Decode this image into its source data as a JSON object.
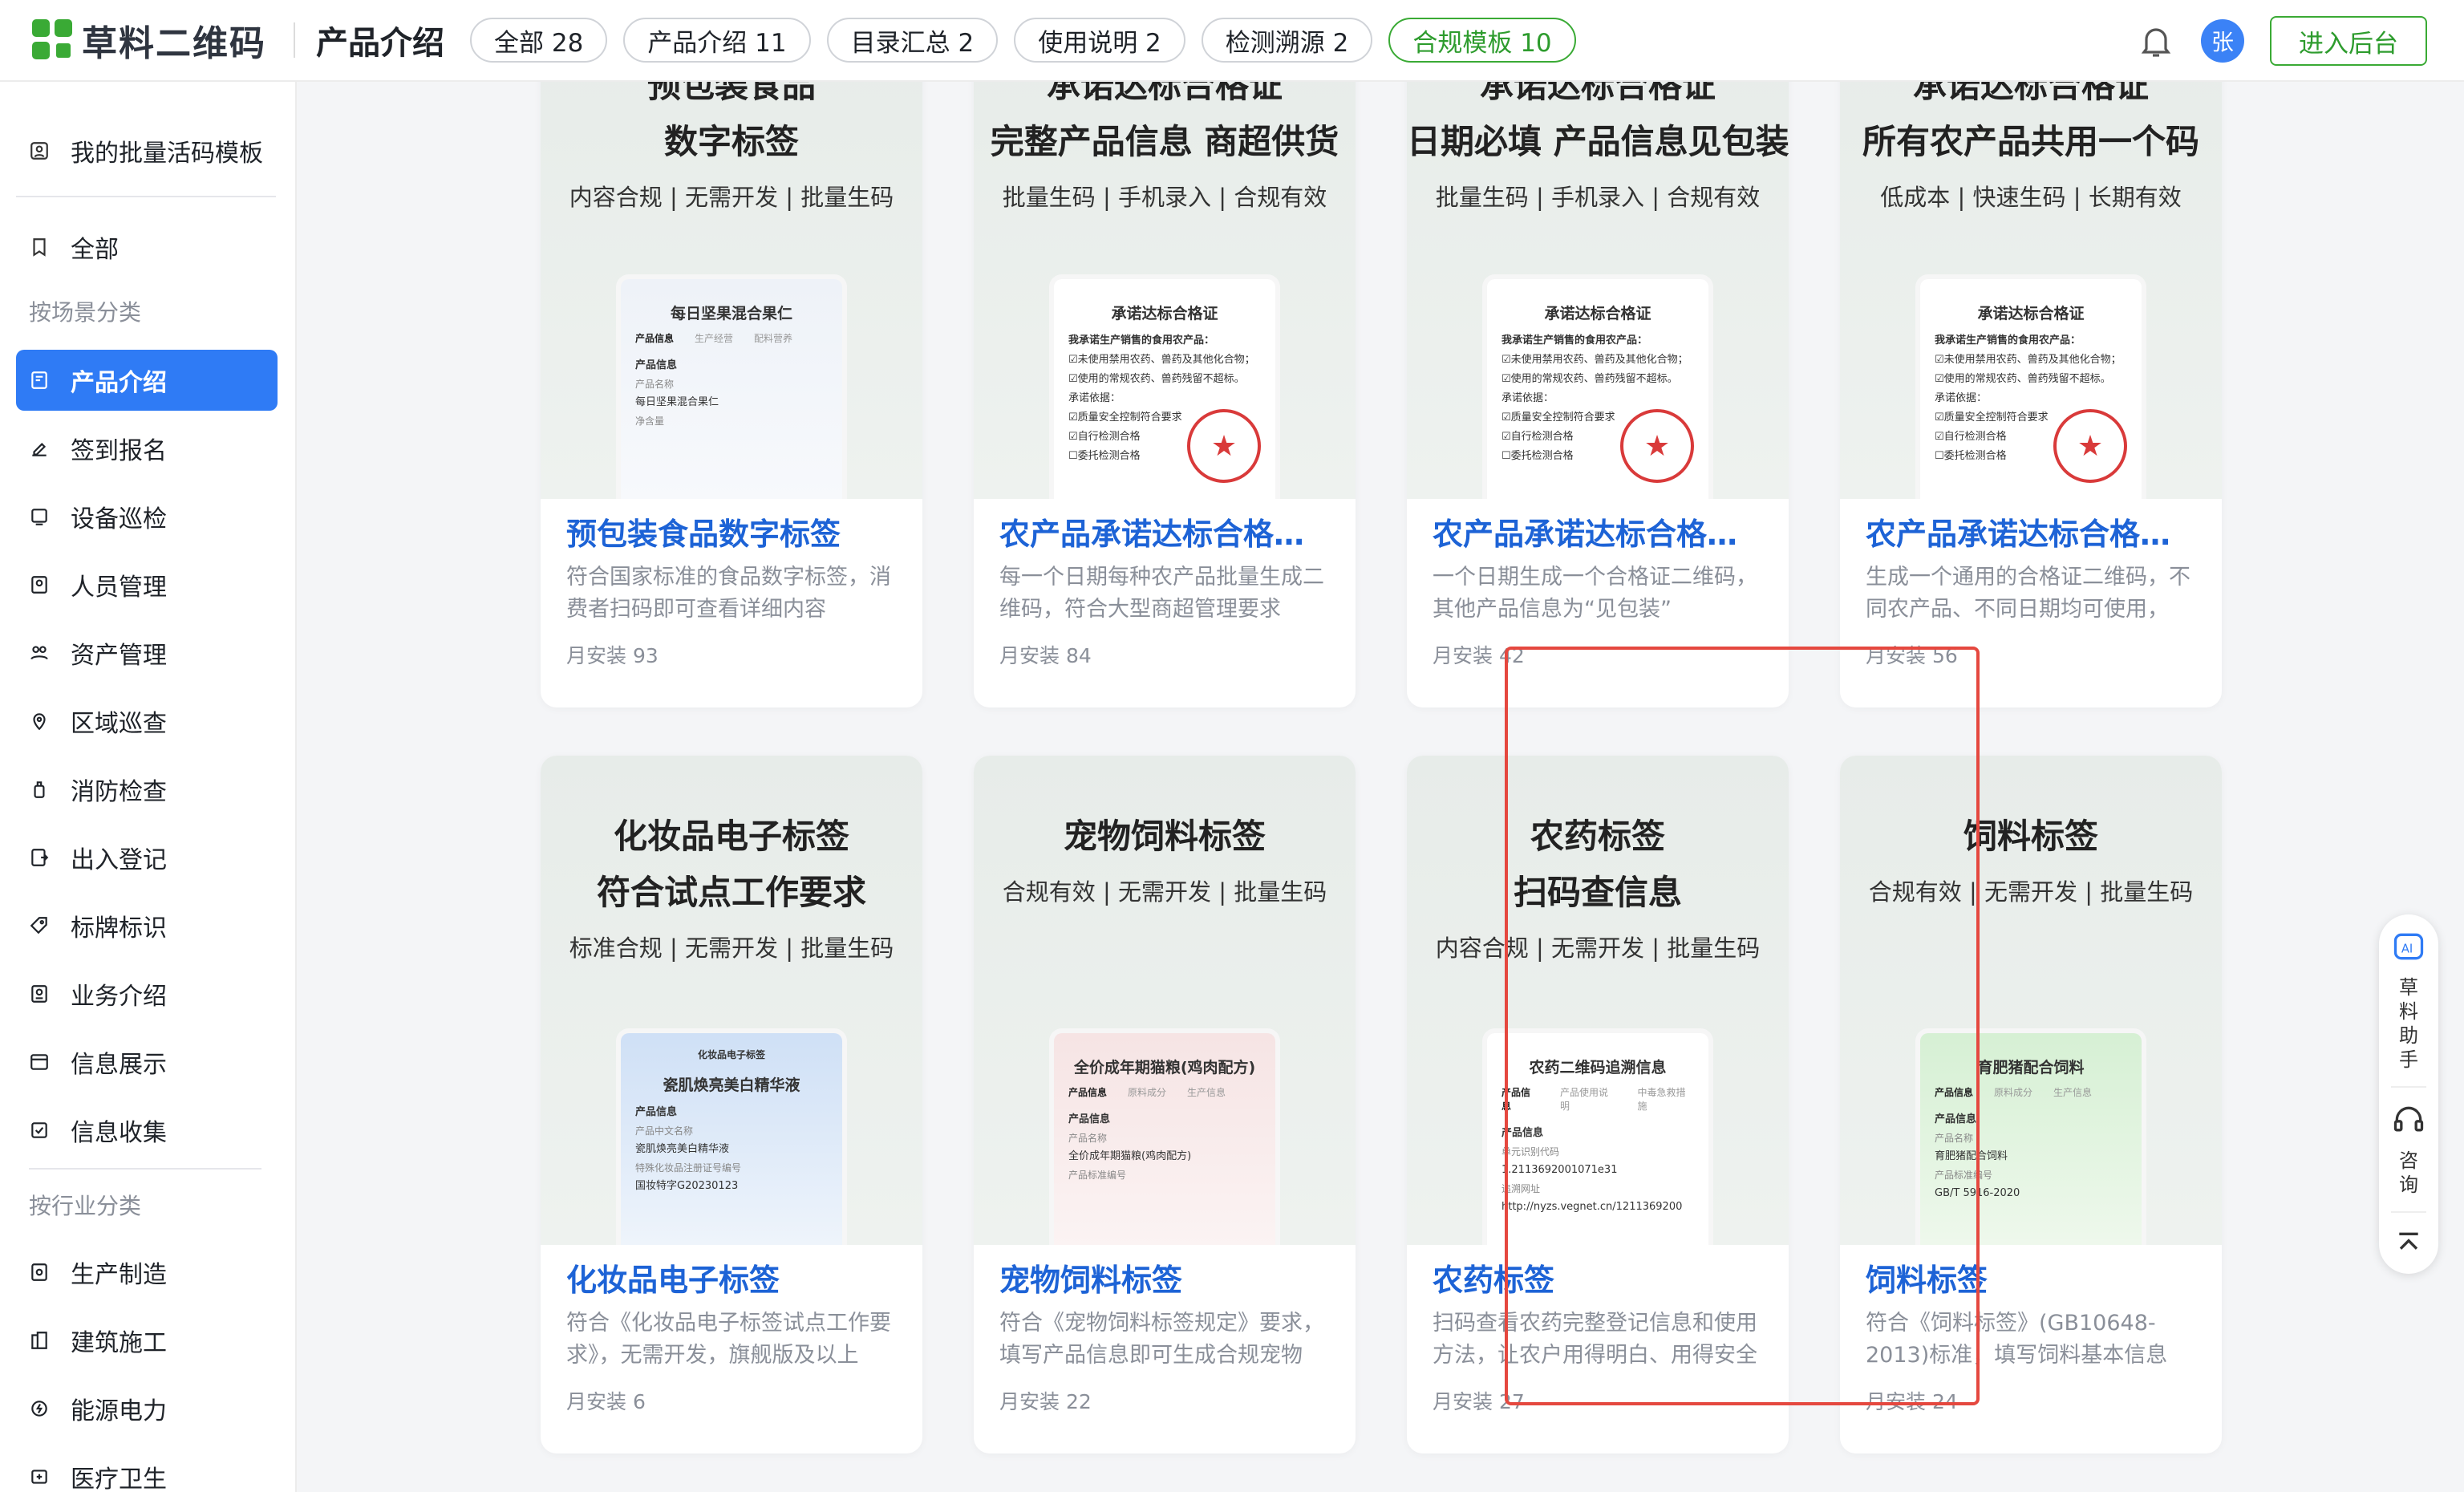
{
  "header": {
    "logo_text": "草料二维码",
    "page_title": "产品介绍",
    "tabs": [
      {
        "label": "全部 28"
      },
      {
        "label": "产品介绍 11"
      },
      {
        "label": "目录汇总 2"
      },
      {
        "label": "使用说明 2"
      },
      {
        "label": "检测溯源 2"
      },
      {
        "label": "合规模板 10"
      }
    ],
    "active_tab": "合规模板 10",
    "avatar_text": "张",
    "enter_button": "进入后台"
  },
  "sidebar": {
    "my_templates": "我的批量活码模板",
    "all": "全部",
    "group_scene": "按场景分类",
    "scene_items": [
      {
        "label": "产品介绍",
        "icon": "doc-icon"
      },
      {
        "label": "签到报名",
        "icon": "edit-icon"
      },
      {
        "label": "设备巡检",
        "icon": "device-icon"
      },
      {
        "label": "人员管理",
        "icon": "person-icon"
      },
      {
        "label": "资产管理",
        "icon": "asset-icon"
      },
      {
        "label": "区域巡查",
        "icon": "location-icon"
      },
      {
        "label": "消防检查",
        "icon": "fire-icon"
      },
      {
        "label": "出入登记",
        "icon": "entry-icon"
      },
      {
        "label": "标牌标识",
        "icon": "tag-icon"
      },
      {
        "label": "业务介绍",
        "icon": "business-icon"
      },
      {
        "label": "信息展示",
        "icon": "display-icon"
      },
      {
        "label": "信息收集",
        "icon": "collect-icon"
      }
    ],
    "group_industry": "按行业分类",
    "industry_items": [
      {
        "label": "生产制造",
        "icon": "factory-icon"
      },
      {
        "label": "建筑施工",
        "icon": "building-icon"
      },
      {
        "label": "能源电力",
        "icon": "power-icon"
      },
      {
        "label": "医疗卫生",
        "icon": "medical-icon"
      }
    ]
  },
  "cards": [
    {
      "poster_lines": [
        "预包装食品",
        "数字标签"
      ],
      "poster_tags": "内容合规 | 无需开发 | 批量生码",
      "phone": {
        "head": "每日坚果混合果仁",
        "tabs": [
          "产品信息",
          "生产经营",
          "配料营养"
        ],
        "section": "产品信息",
        "lines": [
          "产品名称",
          "每日坚果混合果仁",
          "净含量"
        ],
        "seal": false
      },
      "title": "预包装食品数字标签",
      "desc": "符合国家标准的食品数字标签，消费者扫码即可查看详细内容",
      "installs": "月安装  93"
    },
    {
      "poster_lines": [
        "承诺达标合格证",
        "完整产品信息 商超供货"
      ],
      "poster_tags": "批量生码 | 手机录入 | 合规有效",
      "phone": {
        "head": "承诺达标合格证",
        "tabs": [],
        "section": "我承诺生产销售的食用农产品：",
        "lines": [
          "☑未使用禁用农药、兽药及其他化合物；",
          "☑使用的常规农药、兽药残留不超标。",
          "承诺依据：",
          "☑质量安全控制符合要求",
          "☑自行检测合格",
          "☐委托检测合格"
        ],
        "seal": true
      },
      "title": "农产品承诺达标合格证（…",
      "desc": "每一个日期每种农产品批量生成二维码，符合大型商超管理要求",
      "installs": "月安装  84"
    },
    {
      "poster_lines": [
        "承诺达标合格证",
        "日期必填 产品信息见包装"
      ],
      "poster_tags": "批量生码 | 手机录入 | 合规有效",
      "phone": {
        "head": "承诺达标合格证",
        "tabs": [],
        "section": "我承诺生产销售的食用农产品：",
        "lines": [
          "☑未使用禁用农药、兽药及其他化合物；",
          "☑使用的常规农药、兽药残留不超标。",
          "承诺依据：",
          "☑质量安全控制符合要求",
          "☑自行检测合格",
          "☐委托检测合格"
        ],
        "seal": true
      },
      "title": "农产品承诺达标合格证（…",
      "desc": "一个日期生成一个合格证二维码，其他产品信息为“见包装”",
      "installs": "月安装  42"
    },
    {
      "poster_lines": [
        "承诺达标合格证",
        "所有农产品共用一个码"
      ],
      "poster_tags": "低成本 | 快速生码 | 长期有效",
      "phone": {
        "head": "承诺达标合格证",
        "tabs": [],
        "section": "我承诺生产销售的食用农产品：",
        "lines": [
          "☑未使用禁用农药、兽药及其他化合物；",
          "☑使用的常规农药、兽药残留不超标。",
          "承诺依据：",
          "☑质量安全控制符合要求",
          "☑自行检测合格",
          "☐委托检测合格"
        ],
        "seal": true
      },
      "title": "农产品承诺达标合格证（…",
      "desc": "生成一个通用的合格证二维码，不同农产品、不同日期均可使用，所…",
      "installs": "月安装  56"
    },
    {
      "poster_lines": [
        "化妆品电子标签",
        "符合试点工作要求"
      ],
      "poster_tags": "标准合规 | 无需开发 | 批量生码",
      "phone": {
        "head": "瓷肌焕亮美白精华液",
        "tabs": [],
        "section": "产品信息",
        "lines": [
          "产品中文名称",
          "瓷肌焕亮美白精华液",
          "特殊化妆品注册证号编号",
          "国妆特字G20230123"
        ],
        "seal": false,
        "subhead": "化妆品电子标签"
      },
      "title": "化妆品电子标签",
      "desc": "符合《化妆品电子标签试点工作要求》，无需开发，旗舰版及以上可…",
      "installs": "月安装  6"
    },
    {
      "poster_lines": [
        "宠物饲料标签"
      ],
      "poster_tags": "合规有效 | 无需开发 | 批量生码",
      "phone": {
        "head": "全价成年期猫粮(鸡肉配方)",
        "tabs": [
          "产品信息",
          "原料成分",
          "生产信息"
        ],
        "section": "产品信息",
        "lines": [
          "产品名称",
          "全价成年期猫粮(鸡肉配方)",
          "产品标准编号"
        ],
        "seal": false
      },
      "title": "宠物饲料标签",
      "desc": "符合《宠物饲料标签规定》要求，填写产品信息即可生成合规宠物饲…",
      "installs": "月安装  22"
    },
    {
      "poster_lines": [
        "农药标签",
        "扫码查信息"
      ],
      "poster_tags": "内容合规 | 无需开发 | 批量生码",
      "phone": {
        "head": "农药二维码追溯信息",
        "tabs": [
          "产品信息",
          "产品使用说明",
          "中毒急救措施"
        ],
        "section": "产品信息",
        "lines": [
          "单元识别代码",
          "1.2113692001071e31",
          "追溯网址",
          "http://nyzs.vegnet.cn/1211369200"
        ],
        "seal": false
      },
      "title": "农药标签",
      "desc": "扫码查看农药完整登记信息和使用方法，让农户用得明白、用得安全",
      "installs": "月安装  27"
    },
    {
      "poster_lines": [
        "饲料标签"
      ],
      "poster_tags": "合规有效 | 无需开发 | 批量生码",
      "phone": {
        "head": "育肥猪配合饲料",
        "tabs": [
          "产品信息",
          "原料成分",
          "生产信息"
        ],
        "section": "产品信息",
        "lines": [
          "产品名称",
          "育肥猪配合饲料",
          "产品标准编号",
          "GB/T 5916-2020"
        ],
        "seal": false
      },
      "title": "饲料标签",
      "desc": "符合《饲料标签》(GB10648-2013)标准，填写饲料基本信息即…",
      "installs": "月安装  24"
    }
  ],
  "float_tools": {
    "assistant": "草料助手",
    "consult": "咨询"
  }
}
